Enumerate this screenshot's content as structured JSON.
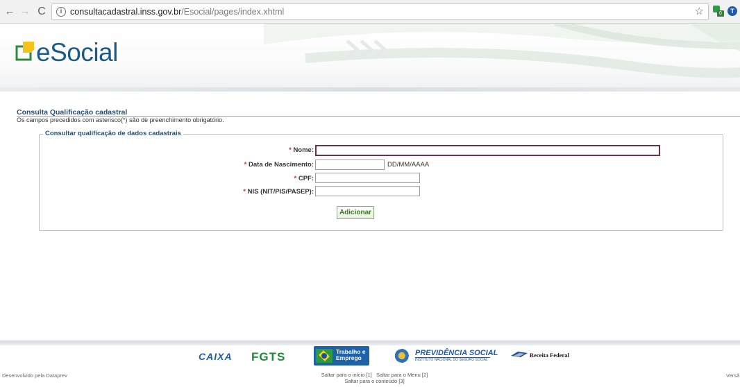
{
  "browser": {
    "url_host": "consultacadastral.inss.gov.br",
    "url_path": "/Esocial/pages/index.xhtml",
    "back_glyph": "←",
    "forward_glyph": "→",
    "reload_glyph": "C",
    "star_glyph": "☆",
    "info_glyph": "i",
    "extension_badge": "0",
    "extension2_glyph": "T",
    "icons": [
      "back-arrow-icon",
      "forward-arrow-icon",
      "reload-icon",
      "info-icon",
      "star-icon",
      "extension-icon",
      "extension-t-icon"
    ]
  },
  "header": {
    "logo_text": "eSocial",
    "logo_color": "#1e5a86"
  },
  "section": {
    "title": "Consulta Qualificação cadastral",
    "hint": "Os campos precedidos com asterisco(*) são de preenchimento obrigatório."
  },
  "form": {
    "legend": "Consultar qualificação de dados cadastrais",
    "required_mark": "*",
    "fields": [
      {
        "label": "Nome:",
        "value": "",
        "placeholder": ""
      },
      {
        "label": "Data de Nascimento:",
        "value": "",
        "placeholder": "",
        "format_hint": "DD/MM/AAAA"
      },
      {
        "label": "CPF:",
        "value": "",
        "placeholder": ""
      },
      {
        "label": "NIS (NIT/PIS/PASEP):",
        "value": "",
        "placeholder": ""
      }
    ],
    "submit_label": "Adicionar"
  },
  "footer": {
    "logos": {
      "caixa": "CAIXA",
      "fgts": "FGTS",
      "trabalho": "Trabalho e Emprego",
      "previdencia": "PREVIDÊNCIA SOCIAL",
      "previdencia_sub": "INSTITUTO NACIONAL DO SEGURO SOCIAL",
      "receita": "Receita Federal"
    },
    "credit": "Desenvolvido pela Dataprev",
    "skip_links": [
      "Saltar para o início [1]",
      "Saltar para o Menu [2]",
      "Saltar para o conteúdo [3]"
    ],
    "version": "Versã"
  },
  "colors": {
    "title": "#2a4e73",
    "required": "#c0392b",
    "button_text": "#3f7a2a",
    "focus_border": "#6a2f52"
  }
}
